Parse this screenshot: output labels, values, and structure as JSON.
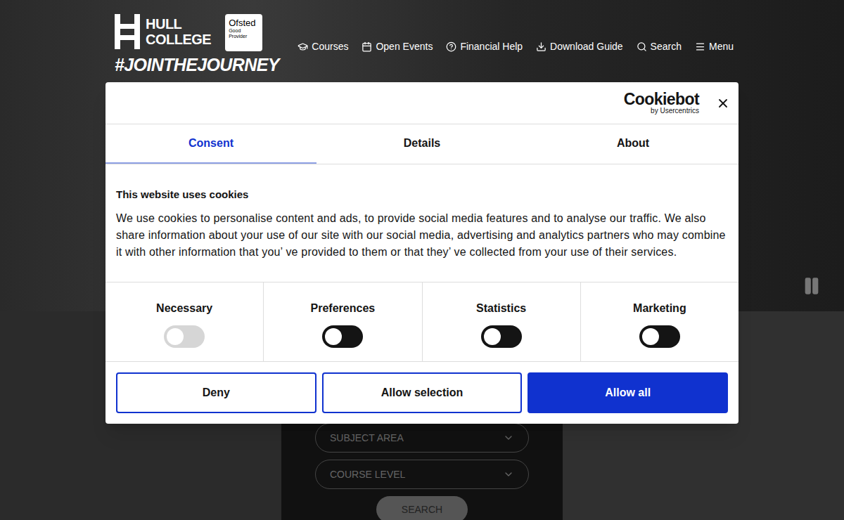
{
  "header": {
    "logo_lines": [
      "HULL",
      "COLLEGE"
    ],
    "ofsted": {
      "name": "Ofsted",
      "lines": [
        "Good",
        "Provider"
      ]
    },
    "hashtag": "#JOINTHEJOURNEY",
    "nav": [
      {
        "label": "Courses",
        "icon": "cap"
      },
      {
        "label": "Open Events",
        "icon": "calendar"
      },
      {
        "label": "Financial Help",
        "icon": "help"
      },
      {
        "label": "Download Guide",
        "icon": "download"
      },
      {
        "label": "Search",
        "icon": "search"
      },
      {
        "label": "Menu",
        "icon": "menu"
      }
    ]
  },
  "search_panel": {
    "fields": [
      "SUBJECT AREA",
      "COURSE LEVEL"
    ],
    "button": "SEARCH"
  },
  "cookie_dialog": {
    "brand": "Cookiebot",
    "brand_sub": "by Usercentrics",
    "tabs": [
      {
        "label": "Consent",
        "selected": true
      },
      {
        "label": "Details",
        "selected": false
      },
      {
        "label": "About",
        "selected": false
      }
    ],
    "title": "This website uses cookies",
    "body": "We use cookies to personalise content and ads, to provide social media features and to analyse our traffic. We also share information about your use of our site with our social media, advertising and analytics partners who may combine it with other information that you’ ve provided to them or that they’ ve collected from your use of their services.",
    "toggles": [
      {
        "label": "Necessary",
        "checked": false,
        "disabled": true
      },
      {
        "label": "Preferences",
        "checked": false,
        "disabled": false
      },
      {
        "label": "Statistics",
        "checked": false,
        "disabled": false
      },
      {
        "label": "Marketing",
        "checked": false,
        "disabled": false
      }
    ],
    "buttons": [
      {
        "label": "Deny",
        "primary": false
      },
      {
        "label": "Allow selection",
        "primary": false
      },
      {
        "label": "Allow all",
        "primary": true
      }
    ]
  }
}
